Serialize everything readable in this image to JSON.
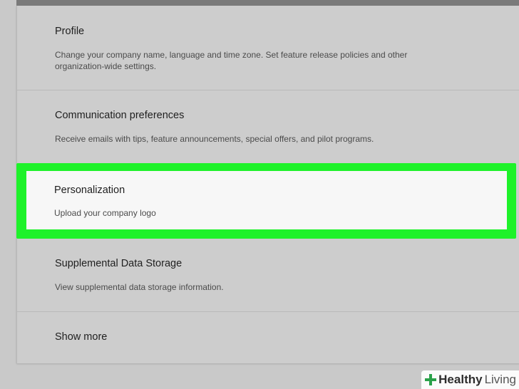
{
  "settings": {
    "rows": [
      {
        "title": "Profile",
        "description": "Change your company name, language and time zone. Set feature release policies and other organization-wide settings."
      },
      {
        "title": "Communication preferences",
        "description": "Receive emails with tips, feature announcements, special offers, and pilot programs."
      },
      {
        "title": "Personalization",
        "description": "Upload your company logo"
      },
      {
        "title": "Supplemental Data Storage",
        "description": "View supplemental data storage information."
      }
    ],
    "show_more_label": "Show more"
  },
  "highlight_color": "#1ef22a",
  "watermark": {
    "icon": "plus-icon",
    "brand_strong": "Healthy",
    "brand_light": "Living"
  }
}
